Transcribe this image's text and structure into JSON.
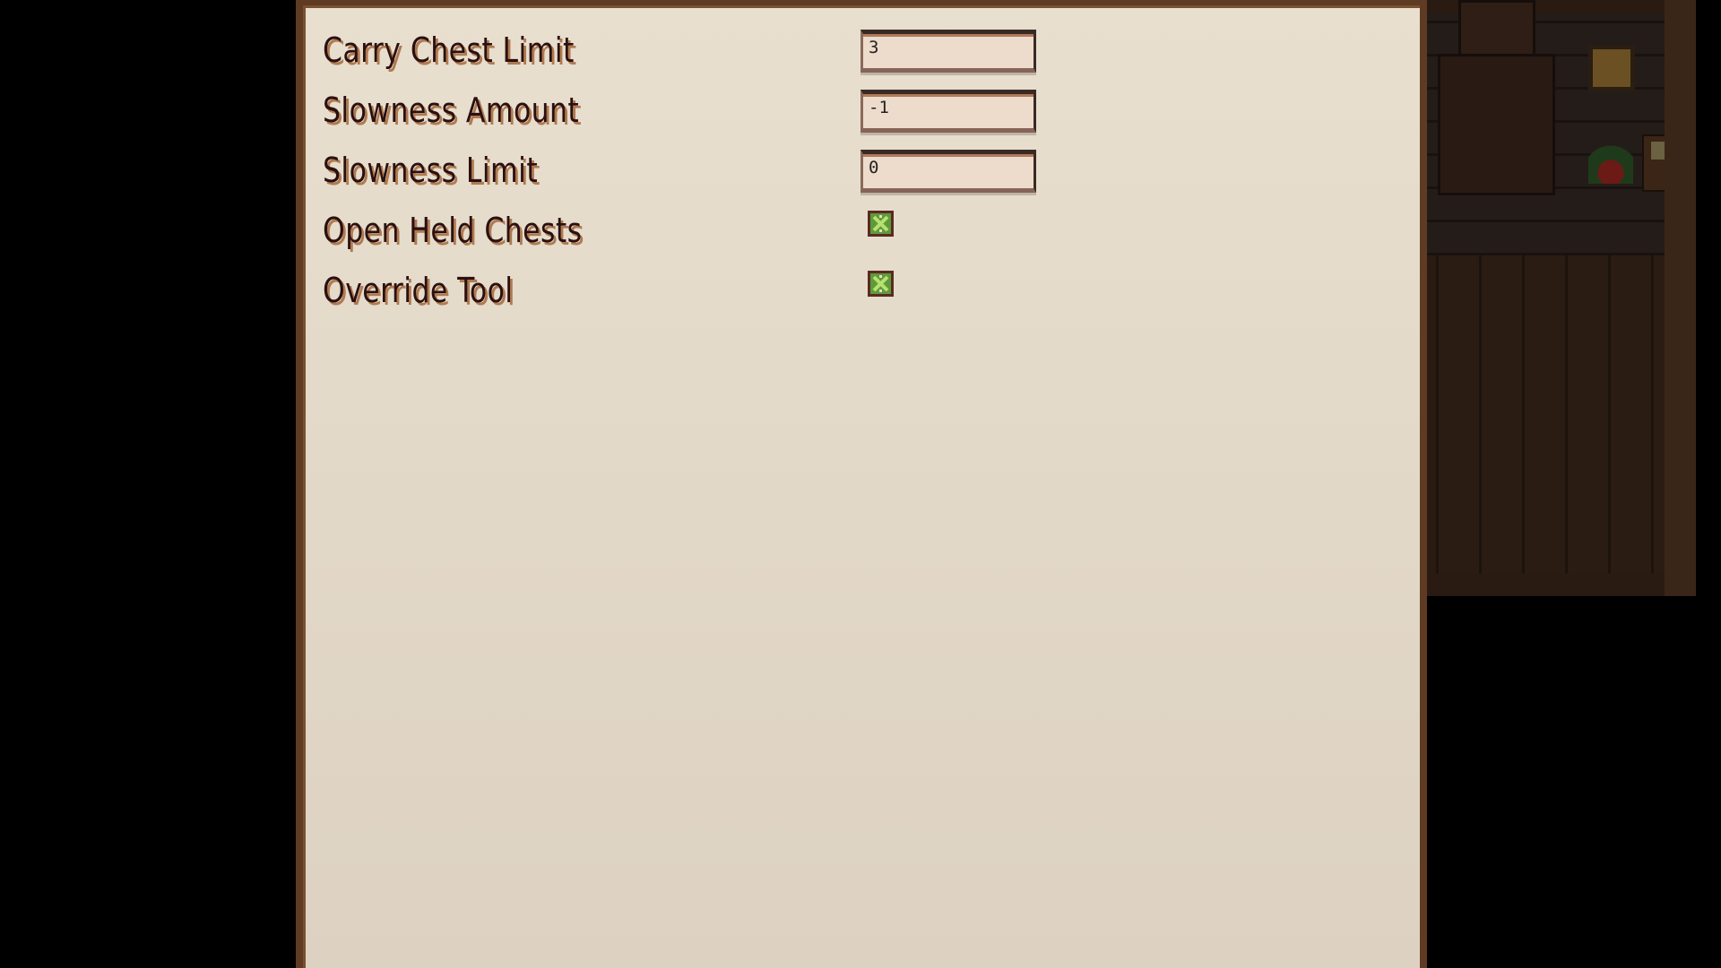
{
  "settings": [
    {
      "label": "Carry Chest Limit",
      "type": "number",
      "value": "3"
    },
    {
      "label": "Slowness Amount",
      "type": "number",
      "value": "-1"
    },
    {
      "label": "Slowness Limit",
      "type": "number",
      "value": "0"
    },
    {
      "label": "Open Held Chests",
      "type": "checkbox",
      "checked": true
    },
    {
      "label": "Override Tool",
      "type": "checkbox",
      "checked": true
    }
  ],
  "colors": {
    "panel": "#e8dfcf",
    "border": "#5e3b22",
    "text": "#2a1010",
    "check": "#5e9a3a"
  }
}
